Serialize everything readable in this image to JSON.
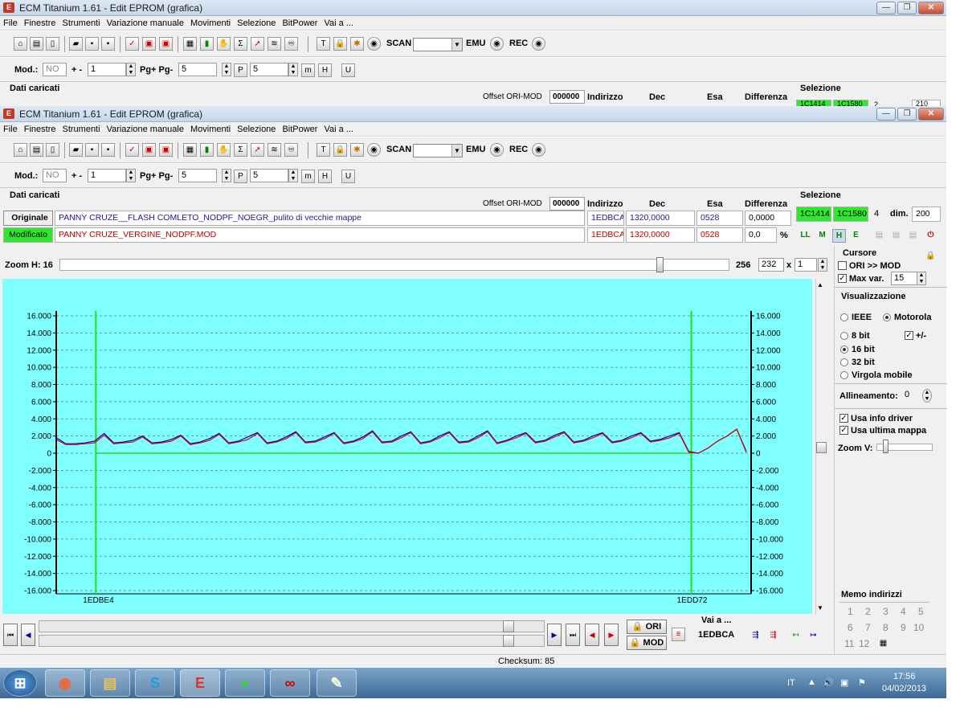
{
  "window": {
    "title": "ECM Titanium 1.61 - Edit EPROM (grafica)",
    "min_label": "—",
    "max_label": "❐",
    "close_label": "✕"
  },
  "menu": [
    "File",
    "Finestre",
    "Strumenti",
    "Variazione manuale",
    "Movimenti",
    "Selezione",
    "BitPower",
    "Vai a ..."
  ],
  "toolbar": {
    "scan_label": "SCAN",
    "emu_label": "EMU",
    "rec_label": "REC"
  },
  "modbar": {
    "mod_label": "Mod.:",
    "mod_value": "NO",
    "plusminus_label": "+ -",
    "plusminus_value": "1",
    "pg_label": "Pg+ Pg-",
    "pg_value": "5",
    "p_value": "5"
  },
  "data": {
    "section_label": "Dati caricati",
    "offset_label": "Offset ORI-MOD",
    "offset_value": "000000",
    "col_indirizzo": "Indirizzo",
    "col_dec": "Dec",
    "col_esa": "Esa",
    "col_diff": "Differenza",
    "original_label": "Originale",
    "original_file": "PANNY CRUZE__FLASH COMLETO_NODPF_NOEGR_pulito di vecchie mappe",
    "original_addr": "1EDBCA",
    "original_dec": "1320,0000",
    "original_esa": "0528",
    "original_diff": "0,0000",
    "modified_label": "Modificato",
    "modified_file": "PANNY CRUZE_VERGINE_NODPF.MOD",
    "modified_addr": "1EDBCA",
    "modified_dec": "1320,0000",
    "modified_esa": "0528",
    "modified_diff": "0,0",
    "percent": "%"
  },
  "selection": {
    "label": "Selezione",
    "start": "1C1414",
    "end": "1C1580",
    "size": "4",
    "dim_label": "dim.",
    "dim_value": "200",
    "back_start": "1C1414",
    "back_end": "1C1580",
    "back_size": "2",
    "back_dim": "210"
  },
  "zoom": {
    "label": "Zoom H: 16",
    "value1": "256",
    "value2": "232",
    "x_label": "x",
    "value3": "1"
  },
  "side": {
    "cursor_label": "Cursore",
    "ori_mod": "ORI >> MOD",
    "maxvar_label": "Max var.",
    "maxvar_value": "15",
    "visual_label": "Visualizzazione",
    "ieee": "IEEE",
    "motorola": "Motorola",
    "bit8": "8 bit",
    "plusminus": "+/-",
    "bit16": "16 bit",
    "bit32": "32 bit",
    "float": "Virgola mobile",
    "align_label": "Allineamento:",
    "align_value": "0",
    "use_driver": "Usa info driver",
    "use_last": "Usa ultima mappa",
    "zoomv": "Zoom V:",
    "memo_label": "Memo indirizzi",
    "memo": [
      "1",
      "2",
      "3",
      "4",
      "5",
      "6",
      "7",
      "8",
      "9",
      "10",
      "11",
      "12"
    ]
  },
  "nav": {
    "ori": "ORI",
    "mod": "MOD",
    "goto_label": "Vai a ...",
    "goto_value": "1EDBCA"
  },
  "status": {
    "checksum": "Checksum: 85"
  },
  "taskbar": {
    "lang": "IT",
    "time": "17:56",
    "date": "04/02/2013"
  },
  "chart_data": {
    "type": "line",
    "ylim": [
      -16000,
      16000
    ],
    "yticks": [
      "16.000",
      "14.000",
      "12.000",
      "10.000",
      "8.000",
      "6.000",
      "4.000",
      "2.000",
      "0",
      "-2.000",
      "-4.000",
      "-6.000",
      "-8.000",
      "-10.000",
      "-12.000",
      "-14.000",
      "-16.000"
    ],
    "x_start_label": "1EDBE4",
    "x_end_label": "1EDD72",
    "grid": true,
    "cursor_positions": [
      0.057,
      0.914
    ],
    "series": [
      {
        "color": "#0000c8",
        "values": [
          1800,
          1100,
          1100,
          1200,
          1400,
          2300,
          1200,
          1300,
          1500,
          2000,
          1200,
          1300,
          1600,
          2100,
          1100,
          1300,
          1700,
          2300,
          1200,
          1400,
          1900,
          2400,
          1200,
          1400,
          1900,
          2500,
          1300,
          1400,
          1900,
          2400,
          1200,
          1400,
          1900,
          2600,
          1300,
          1400,
          2000,
          2500,
          1200,
          1400,
          2000,
          2500,
          1300,
          1400,
          2000,
          2600,
          1200,
          1500,
          2000,
          2400,
          1300,
          1500,
          2100,
          2500,
          1300,
          1500,
          2000,
          2400,
          1300,
          1500,
          2000,
          2400,
          1400,
          1600,
          2000,
          2400,
          200,
          0,
          600,
          1400,
          2000,
          2800,
          200
        ]
      },
      {
        "color": "#e00000",
        "values": [
          1600,
          1000,
          1000,
          1100,
          1200,
          2100,
          1100,
          1200,
          1300,
          1900,
          1100,
          1200,
          1400,
          2000,
          1000,
          1200,
          1500,
          2200,
          1100,
          1300,
          1600,
          2300,
          1100,
          1300,
          1700,
          2400,
          1200,
          1300,
          1700,
          2300,
          1100,
          1300,
          1700,
          2500,
          1200,
          1300,
          1800,
          2400,
          1100,
          1300,
          1800,
          2400,
          1200,
          1300,
          1800,
          2500,
          1100,
          1400,
          1800,
          2300,
          1200,
          1400,
          1900,
          2400,
          1200,
          1400,
          1800,
          2300,
          1200,
          1400,
          1800,
          2300,
          1300,
          1500,
          1800,
          2300,
          100,
          0,
          600,
          1400,
          2000,
          2800,
          100
        ]
      }
    ]
  }
}
